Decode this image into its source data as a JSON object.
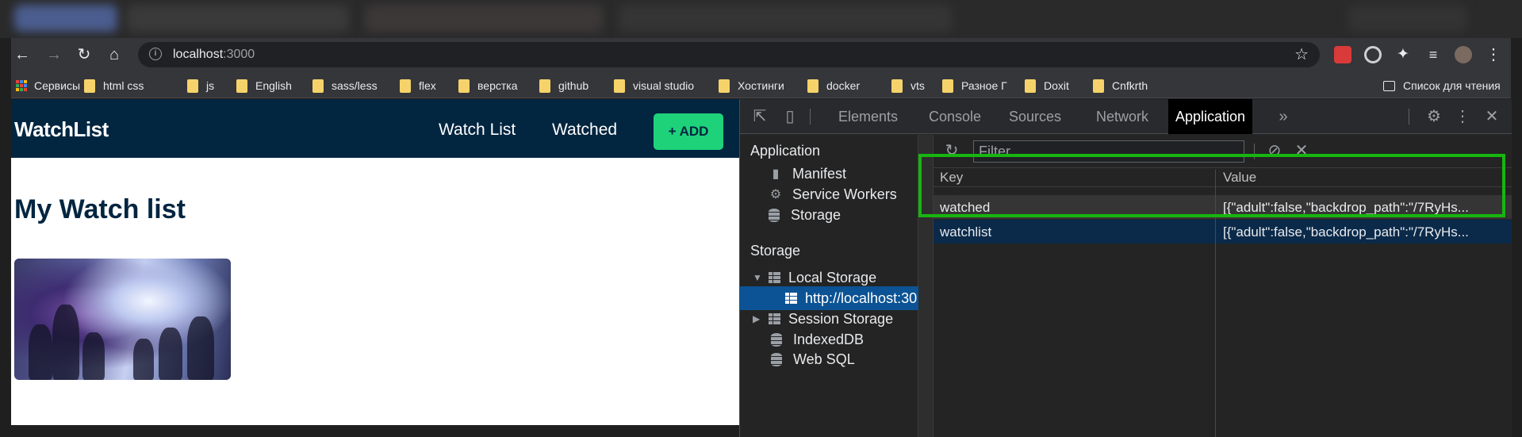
{
  "browser": {
    "address": {
      "host": "localhost",
      "port": ":3000"
    },
    "bookmarks": [
      "Сервисы",
      "html css",
      "js",
      "English",
      "sass/less",
      "flex",
      "верстка",
      "github",
      "visual studio",
      "Хостинги",
      "docker",
      "vts",
      "Разное Г",
      "Doxit",
      "Cnfkrth"
    ],
    "reading_list": "Список для чтения"
  },
  "app": {
    "brand": "WatchList",
    "nav": {
      "watch_list": "Watch List",
      "watched": "Watched",
      "add": "+ ADD"
    },
    "heading": "My Watch list"
  },
  "devtools": {
    "tabs": [
      "Elements",
      "Console",
      "Sources",
      "Network",
      "Application"
    ],
    "active_tab": "Application",
    "more": "»",
    "sidebar": {
      "application_header": "Application",
      "application_items": [
        "Manifest",
        "Service Workers",
        "Storage"
      ],
      "storage_header": "Storage",
      "local_storage": "Local Storage",
      "local_origin": "http://localhost:30",
      "session_storage": "Session Storage",
      "indexeddb": "IndexedDB",
      "websql": "Web SQL"
    },
    "filter_placeholder": "Filter",
    "columns": {
      "key": "Key",
      "value": "Value"
    },
    "rows": [
      {
        "key": "watched",
        "value": "[{\"adult\":false,\"backdrop_path\":\"/7RyHs..."
      },
      {
        "key": "watchlist",
        "value": "[{\"adult\":false,\"backdrop_path\":\"/7RyHs..."
      }
    ]
  },
  "colors": {
    "navbar": "#022540",
    "add_button": "#1ed27a",
    "highlight_box": "#17b50f",
    "selected_row": "#0b5394"
  }
}
